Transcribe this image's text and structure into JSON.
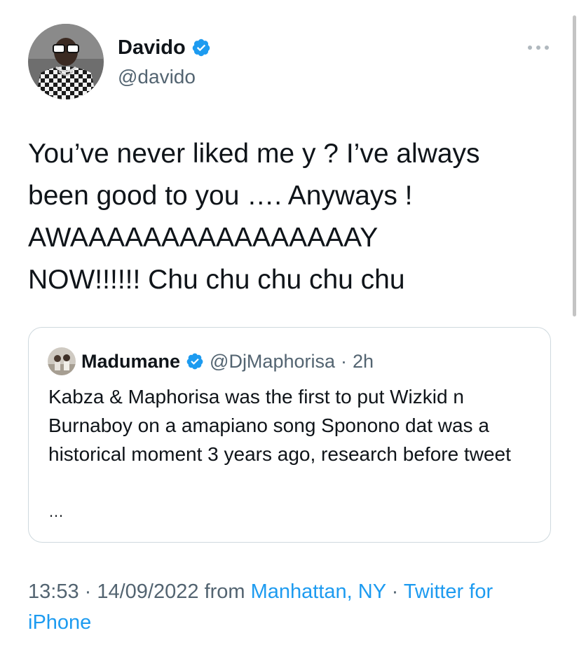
{
  "author": {
    "name": "Davido",
    "handle": "@davido",
    "verified_icon": "verified-badge-icon"
  },
  "more_icon": "more-options-icon",
  "tweet": {
    "text": "You’ve never liked me y ? I’ve always\nbeen good to you …. Anyways !\nAWAAAAAAAAAAAAAAAAY\nNOW!!!!!! Chu chu chu chu chu"
  },
  "quote": {
    "name": "Madumane",
    "handle": "@DjMaphorisa",
    "separator": "·",
    "time": "2h",
    "text": "Kabza & Maphorisa was the first to put Wizkid n Burnaboy on a amapiano song Sponono dat was a historical moment 3 years ago, research before tweet",
    "more": "…"
  },
  "meta": {
    "time": "13:53",
    "sep1": " · ",
    "date": "14/09/2022",
    "from": " from ",
    "location": "Manhattan, NY",
    "sep2": " · ",
    "source": "Twitter for iPhone"
  },
  "colors": {
    "accent": "#1d9bf0",
    "text": "#0f1419",
    "secondary": "#536471",
    "border": "#cfd9de"
  }
}
